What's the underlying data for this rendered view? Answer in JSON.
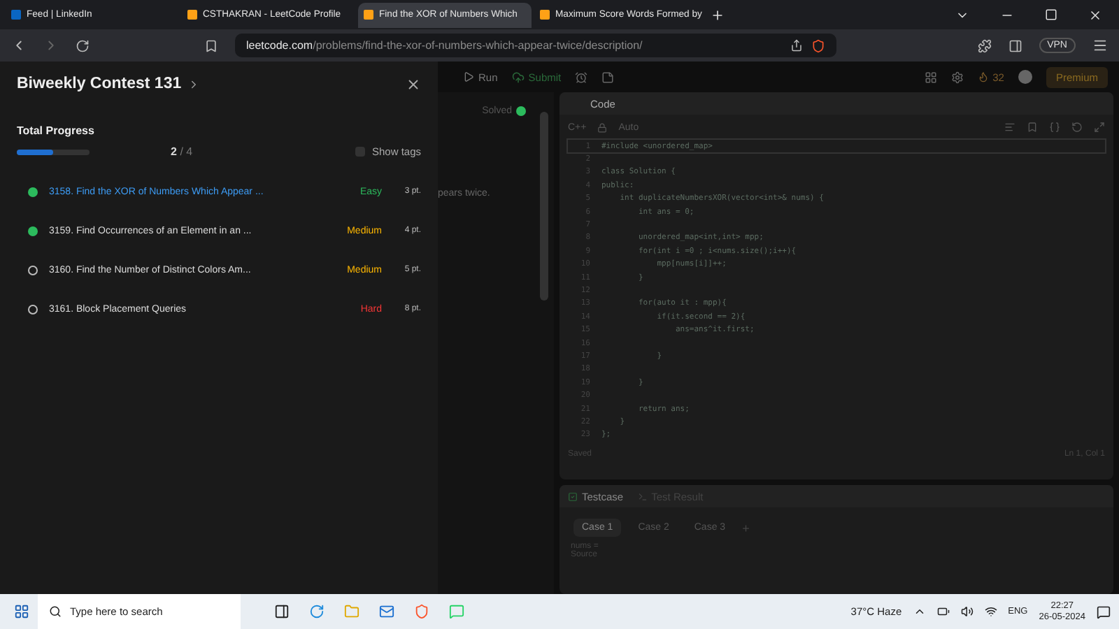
{
  "browser": {
    "tabs": [
      {
        "label": "Feed | LinkedIn",
        "selected": false
      },
      {
        "label": "CSTHAKRAN - LeetCode Profile",
        "selected": false
      },
      {
        "label": "Find the XOR of Numbers Which",
        "selected": true
      },
      {
        "label": "Maximum Score Words Formed by",
        "selected": false
      }
    ],
    "url_host": "leetcode.com",
    "url_path": "/problems/find-the-xor-of-numbers-which-appear-twice/description/",
    "vpn": "VPN"
  },
  "drawer": {
    "title": "Biweekly Contest 131",
    "progress_label": "Total Progress",
    "progress": {
      "level": 0.5
    },
    "solved": "2",
    "total": "/ 4",
    "show_tags": {
      "label": "Show tags",
      "checked": false
    },
    "problems": [
      {
        "title": "3158. Find the XOR of Numbers Which Appear ...",
        "difficulty": "Easy",
        "kind": "easy",
        "points": "3 pt.",
        "solved": true,
        "selected": true
      },
      {
        "title": "3159. Find Occurrences of an Element in an ...",
        "difficulty": "Medium",
        "kind": "medium",
        "points": "4 pt.",
        "solved": true,
        "selected": false
      },
      {
        "title": "3160. Find the Number of Distinct Colors Am...",
        "difficulty": "Medium",
        "kind": "medium",
        "points": "5 pt.",
        "solved": false,
        "selected": false
      },
      {
        "title": "3161. Block Placement Queries",
        "difficulty": "Hard",
        "kind": "hard",
        "points": "8 pt.",
        "solved": false,
        "selected": false
      }
    ]
  },
  "toolbar": {
    "run": "Run",
    "submit": "Submit",
    "streak": "32",
    "premium": "Premium"
  },
  "problem": {
    "status": "Solved",
    "text": "pears twice."
  },
  "editor": {
    "title": "Code",
    "language": "C++",
    "mode": "Auto",
    "lines": [
      {
        "number": "1",
        "text": "#include <unordered_map>"
      },
      {
        "number": "2"
      },
      {
        "number": "3",
        "text": "class Solution {"
      },
      {
        "number": "4",
        "text": "public:"
      },
      {
        "number": "5",
        "text": "    int duplicateNumbersXOR(vector<int>& nums) {"
      },
      {
        "number": "6",
        "text": "        int ans = 0;"
      },
      {
        "number": "7"
      },
      {
        "number": "8",
        "text": "        unordered_map<int,int> mpp;"
      },
      {
        "number": "9",
        "text": "        for(int i =0 ; i<nums.size();i++){"
      },
      {
        "number": "10",
        "text": "            mpp[nums[i]]++;"
      },
      {
        "number": "11",
        "text": "        }"
      },
      {
        "number": "12"
      },
      {
        "number": "13",
        "text": "        for(auto it : mpp){"
      },
      {
        "number": "14",
        "text": "            if(it.second == 2){"
      },
      {
        "number": "15",
        "text": "                ans=ans^it.first;"
      },
      {
        "number": "16"
      },
      {
        "number": "17",
        "text": "            }"
      },
      {
        "number": "18"
      },
      {
        "number": "19",
        "text": "        }"
      },
      {
        "number": "20"
      },
      {
        "number": "21",
        "text": "        return ans;"
      },
      {
        "number": "22",
        "text": "    }"
      },
      {
        "number": "23",
        "text": "};"
      }
    ],
    "saved": "Saved",
    "cursor": "Ln 1, Col 1"
  },
  "testcase": {
    "tabs": [
      {
        "label": "Testcase",
        "selected": true
      },
      {
        "label": "Test Result",
        "selected": false
      }
    ],
    "cases": [
      {
        "label": "Case 1",
        "selected": true
      },
      {
        "label": "Case 2",
        "selected": false
      },
      {
        "label": "Case 3",
        "selected": false
      }
    ],
    "add": "+",
    "input_label": "nums =",
    "source": "Source"
  },
  "taskbar": {
    "search_placeholder": "Type here to search",
    "weather": "37°C  Haze",
    "language": "ENG",
    "time": "22:27",
    "date": "26-05-2024"
  }
}
